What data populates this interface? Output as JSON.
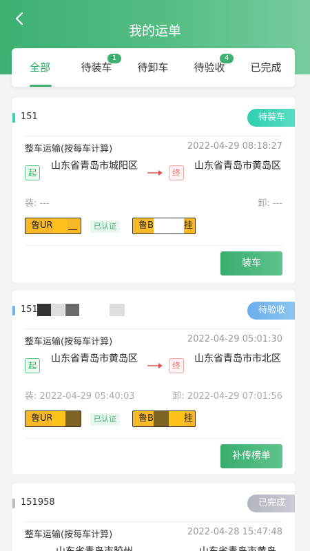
{
  "header": {
    "title": "我的运单"
  },
  "tabs": [
    {
      "label": "全部",
      "active": true
    },
    {
      "label": "待装车",
      "badge": "1"
    },
    {
      "label": "待卸车"
    },
    {
      "label": "待验收",
      "badge": "4"
    },
    {
      "label": "已完成"
    }
  ],
  "orders": [
    {
      "id": "151",
      "status": "待装车",
      "status_color": "#3fcfb0",
      "service_type": "整车运输(按每车计算)",
      "time": "2022-04-29 08:18:27",
      "start_tag": "起",
      "end_tag": "终",
      "from": "山东省青岛市城阳区",
      "to": "山东省青岛市黄岛区",
      "load_label": "装: ---",
      "unload_label": "卸: ---",
      "plate_1": "鲁UR",
      "plate_1_tail": "__",
      "cert": "已认证",
      "plate_2": "鲁B",
      "plate_2_tail": "挂",
      "action": "装车"
    },
    {
      "id": "151",
      "status": "待验收",
      "status_color": "#6fb2ec",
      "service_type": "整车运输(按每车计算)",
      "time": "2022-04-29 05:01:30",
      "start_tag": "起",
      "end_tag": "终",
      "from": "山东省青岛市黄岛区",
      "to": "山东省青岛市市北区",
      "load_label": "装: 2022-04-29 05:40:03",
      "unload_label": "卸: 2022-04-29 07:01:56",
      "plate_1": "鲁UR",
      "cert": "已认证",
      "plate_2": "鲁B",
      "plate_2_tail": "挂",
      "action": "补传榜单"
    },
    {
      "id": "151958",
      "status": "已完成",
      "status_color": "#b9bcc6",
      "service_type": "整车运输(按每车计算)",
      "time": "2022-04-28 15:47:48",
      "from": "山东省青岛市胶州",
      "to": "山东省青岛市黄岛"
    }
  ]
}
